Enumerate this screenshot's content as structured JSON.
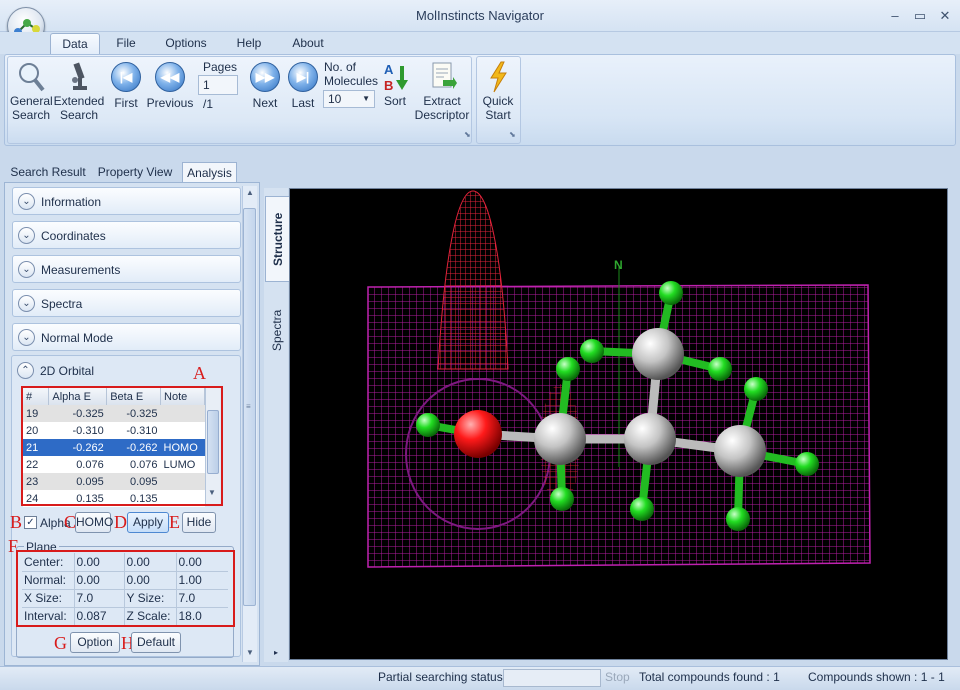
{
  "window": {
    "title": "MolInstincts Navigator"
  },
  "menu": {
    "tabs": [
      "Data",
      "File",
      "Options",
      "Help",
      "About"
    ],
    "active": "Data"
  },
  "ribbon": {
    "general_search": "General\nSearch",
    "extended_search": "Extended\nSearch",
    "first": "First",
    "previous": "Previous",
    "pages_label": "Pages",
    "page_value": "1",
    "page_total": "/1",
    "next": "Next",
    "last": "Last",
    "molecules_label": "No. of\nMolecules",
    "molecules_value": "10",
    "sort": "Sort",
    "extract": "Extract\nDescriptor",
    "quick_start": "Quick\nStart"
  },
  "view_tabs": [
    "Search Result",
    "Property View",
    "Analysis"
  ],
  "sections": [
    "Information",
    "Coordinates",
    "Measurements",
    "Spectra",
    "Normal Mode",
    "2D Orbital"
  ],
  "orbital": {
    "columns": [
      "#",
      "Alpha E",
      "Beta E",
      "Note"
    ],
    "rows": [
      {
        "num": "19",
        "alpha": "-0.325",
        "beta": "-0.325",
        "note": ""
      },
      {
        "num": "20",
        "alpha": "-0.310",
        "beta": "-0.310",
        "note": ""
      },
      {
        "num": "21",
        "alpha": "-0.262",
        "beta": "-0.262",
        "note": "HOMO"
      },
      {
        "num": "22",
        "alpha": "0.076",
        "beta": "0.076",
        "note": "LUMO"
      },
      {
        "num": "23",
        "alpha": "0.095",
        "beta": "0.095",
        "note": ""
      },
      {
        "num": "24",
        "alpha": "0.135",
        "beta": "0.135",
        "note": ""
      }
    ],
    "selected_row": "21",
    "alpha_label": "Alpha",
    "alpha_checked": true,
    "homo_button": "HOMO",
    "apply_button": "Apply",
    "hide_button": "Hide"
  },
  "plane": {
    "title": "Plane",
    "center_label": "Center:",
    "center": [
      "0.00",
      "0.00",
      "0.00"
    ],
    "normal_label": "Normal:",
    "normal": [
      "0.00",
      "0.00",
      "1.00"
    ],
    "xsize_label": "X Size:",
    "xsize": "7.0",
    "ysize_label": "Y Size:",
    "ysize": "7.0",
    "interval_label": "Interval:",
    "interval": "0.087",
    "zscale_label": "Z Scale:",
    "zscale": "18.0",
    "option_button": "Option",
    "default_button": "Default"
  },
  "annotations": [
    "A",
    "B",
    "C",
    "D",
    "E",
    "F",
    "G",
    "H"
  ],
  "viewer": {
    "tabs": [
      "Structure",
      "Spectra"
    ],
    "axis_label": "N"
  },
  "status": {
    "partial_label": "Partial searching status :",
    "stop_button": "Stop",
    "total": "Total compounds found : 1",
    "shown": "Compounds shown : 1 - 1"
  },
  "colors": {
    "accent": "#2e6bc6",
    "annotation": "#d81b1b",
    "mesh_low": "#b01d9e",
    "mesh_peak": "#e0233a"
  }
}
